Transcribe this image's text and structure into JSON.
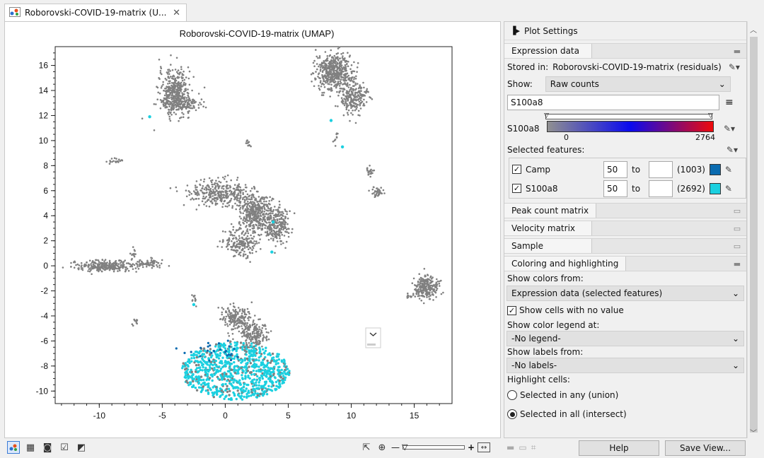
{
  "tab": {
    "title": "Roborovski-COVID-19-matrix (U...",
    "close": "✕"
  },
  "plot": {
    "title": "Roborovski-COVID-19-matrix (UMAP)",
    "x_ticks": [
      "-10",
      "-5",
      "0",
      "5",
      "10",
      "15"
    ],
    "y_ticks": [
      "16",
      "14",
      "12",
      "10",
      "8",
      "6",
      "4",
      "2",
      "0",
      "-2",
      "-4",
      "-6",
      "-8",
      "-10"
    ],
    "x_range": [
      -13.5,
      18
    ],
    "y_range": [
      -11,
      17.5
    ],
    "colors": {
      "cells": "#808080",
      "camp": "#0a6bb0",
      "s100a8": "#1bd0e0"
    }
  },
  "settings": {
    "title": "Plot Settings",
    "expression": {
      "header": "Expression data",
      "stored_in_label": "Stored in:",
      "stored_in_value": "Roborovski-COVID-19-matrix (residuals)",
      "show_label": "Show:",
      "show_value": "Raw counts",
      "feature_value": "S100a8",
      "gradient_label": "S100a8",
      "gradient_min": "0",
      "gradient_max": "2764",
      "selected_features_label": "Selected features:",
      "features": [
        {
          "name": "Camp",
          "min": "50",
          "to": "to",
          "max": "",
          "count": "(1003)",
          "color": "#0a6bb0"
        },
        {
          "name": "S100a8",
          "min": "50",
          "to": "to",
          "max": "",
          "count": "(2692)",
          "color": "#1bd0e0"
        }
      ]
    },
    "collapsed": [
      "Peak count matrix",
      "Velocity matrix",
      "Sample"
    ],
    "coloring": {
      "header": "Coloring and highlighting",
      "show_colors_label": "Show colors from:",
      "show_colors_value": "Expression data (selected features)",
      "show_no_value_label": "Show cells with no value",
      "legend_label": "Show color legend at:",
      "legend_value": "-No legend-",
      "labels_label": "Show labels from:",
      "labels_value": "-No labels-",
      "highlight_label": "Highlight cells:",
      "option_union": "Selected in any (union)",
      "option_intersect": "Selected in all (intersect)"
    }
  },
  "footer": {
    "help": "Help",
    "save_view": "Save View..."
  }
}
